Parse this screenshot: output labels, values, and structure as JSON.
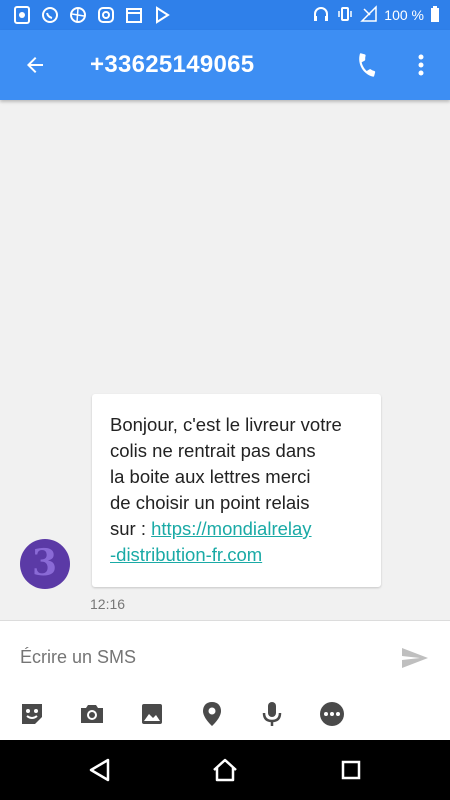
{
  "status_bar": {
    "battery_text": "100 %"
  },
  "header": {
    "title": "+33625149065"
  },
  "conversation": {
    "message_lines": [
      "Bonjour, c'est le livreur votre",
      "colis ne rentrait pas dans",
      "la boite aux lettres merci",
      "de choisir un point relais",
      "sur : "
    ],
    "link_line_1": "https://mondialrelay",
    "link_line_2": "-distribution-fr.com",
    "timestamp": "12:16",
    "avatar_text": "3"
  },
  "composer": {
    "placeholder": "Écrire un SMS",
    "attachment_icons": [
      "sticker-icon",
      "camera-icon",
      "image-icon",
      "location-icon",
      "microphone-icon",
      "more-icon"
    ]
  },
  "colors": {
    "appbar": "#3d8ef3",
    "statusbar": "#2f80ea",
    "link": "#1aaaa6",
    "avatar": "#5b3aa6"
  }
}
